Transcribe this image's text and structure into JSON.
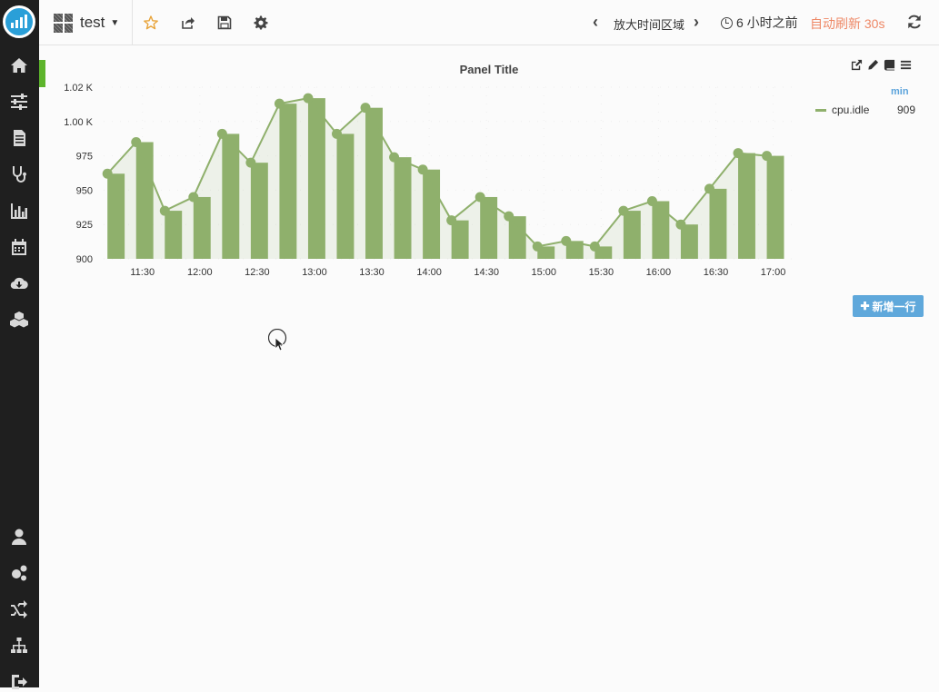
{
  "topbar": {
    "dashboard_title": "test",
    "zoom_label": "放大时间区域",
    "time_range": "6 小时之前",
    "auto_refresh": "自动刷新 30s"
  },
  "panel": {
    "title": "Panel Title",
    "legend_header": "min",
    "add_row_label": "新增一行"
  },
  "colors": {
    "series": "#8fb06c",
    "accent": "#5fa8db",
    "refresh": "#ee8866",
    "panel_marker": "#5db42c"
  },
  "chart_data": {
    "type": "bar",
    "title": "Panel Title",
    "xlabel": "",
    "ylabel": "",
    "ylim": [
      900,
      1025
    ],
    "y_ticks": [
      "900",
      "925",
      "950",
      "975",
      "1.00 K",
      "1.02 K"
    ],
    "y_tick_values": [
      900,
      925,
      950,
      975,
      1000,
      1025
    ],
    "x_ticks": [
      "11:30",
      "12:00",
      "12:30",
      "13:00",
      "13:30",
      "14:00",
      "14:30",
      "15:00",
      "15:30",
      "16:00",
      "16:30",
      "17:00"
    ],
    "x_tick_minutes": [
      690,
      720,
      750,
      780,
      810,
      840,
      870,
      900,
      930,
      960,
      990,
      1020
    ],
    "series": [
      {
        "name": "cpu.idle",
        "legend_min": "909",
        "x_minutes": [
          675,
          690,
          705,
          720,
          735,
          750,
          765,
          780,
          795,
          810,
          825,
          840,
          855,
          870,
          885,
          900,
          915,
          930,
          945,
          960,
          975,
          990,
          1005,
          1020
        ],
        "values": [
          962,
          985,
          935,
          945,
          991,
          970,
          1013,
          1017,
          991,
          1010,
          974,
          965,
          928,
          945,
          931,
          909,
          913,
          909,
          935,
          942,
          925,
          951,
          977,
          975
        ]
      }
    ]
  }
}
